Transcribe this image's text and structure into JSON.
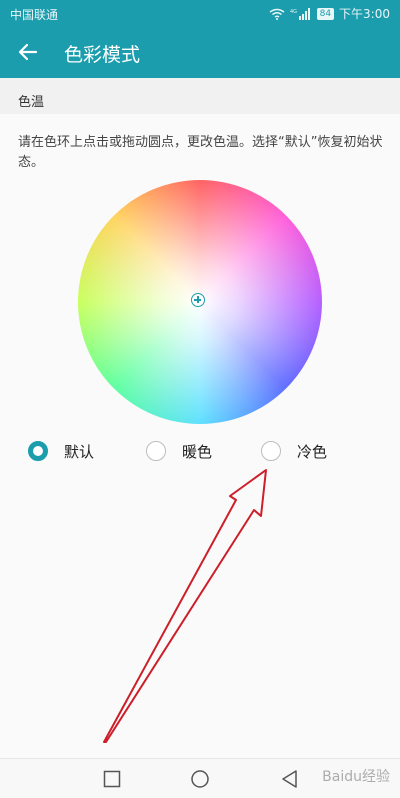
{
  "status_bar": {
    "carrier": "中国联通",
    "network": "4G",
    "battery": "84",
    "time": "下午3:00"
  },
  "title_bar": {
    "title": "色彩模式",
    "back_icon": "arrow-left-icon"
  },
  "section": {
    "title": "色温",
    "description": "请在色环上点击或拖动圆点，更改色温。选择“默认”恢复初始状态。"
  },
  "options": [
    {
      "label": "默认",
      "checked": true
    },
    {
      "label": "暖色",
      "checked": false
    },
    {
      "label": "冷色",
      "checked": false
    }
  ],
  "nav": {
    "square_icon": "recent-apps-icon",
    "circle_icon": "home-icon",
    "triangle_icon": "back-triangle-icon"
  },
  "watermark": "Baidu经验",
  "colors": {
    "accent": "#1b9dae",
    "annotation_arrow": "#cc1f2a"
  }
}
